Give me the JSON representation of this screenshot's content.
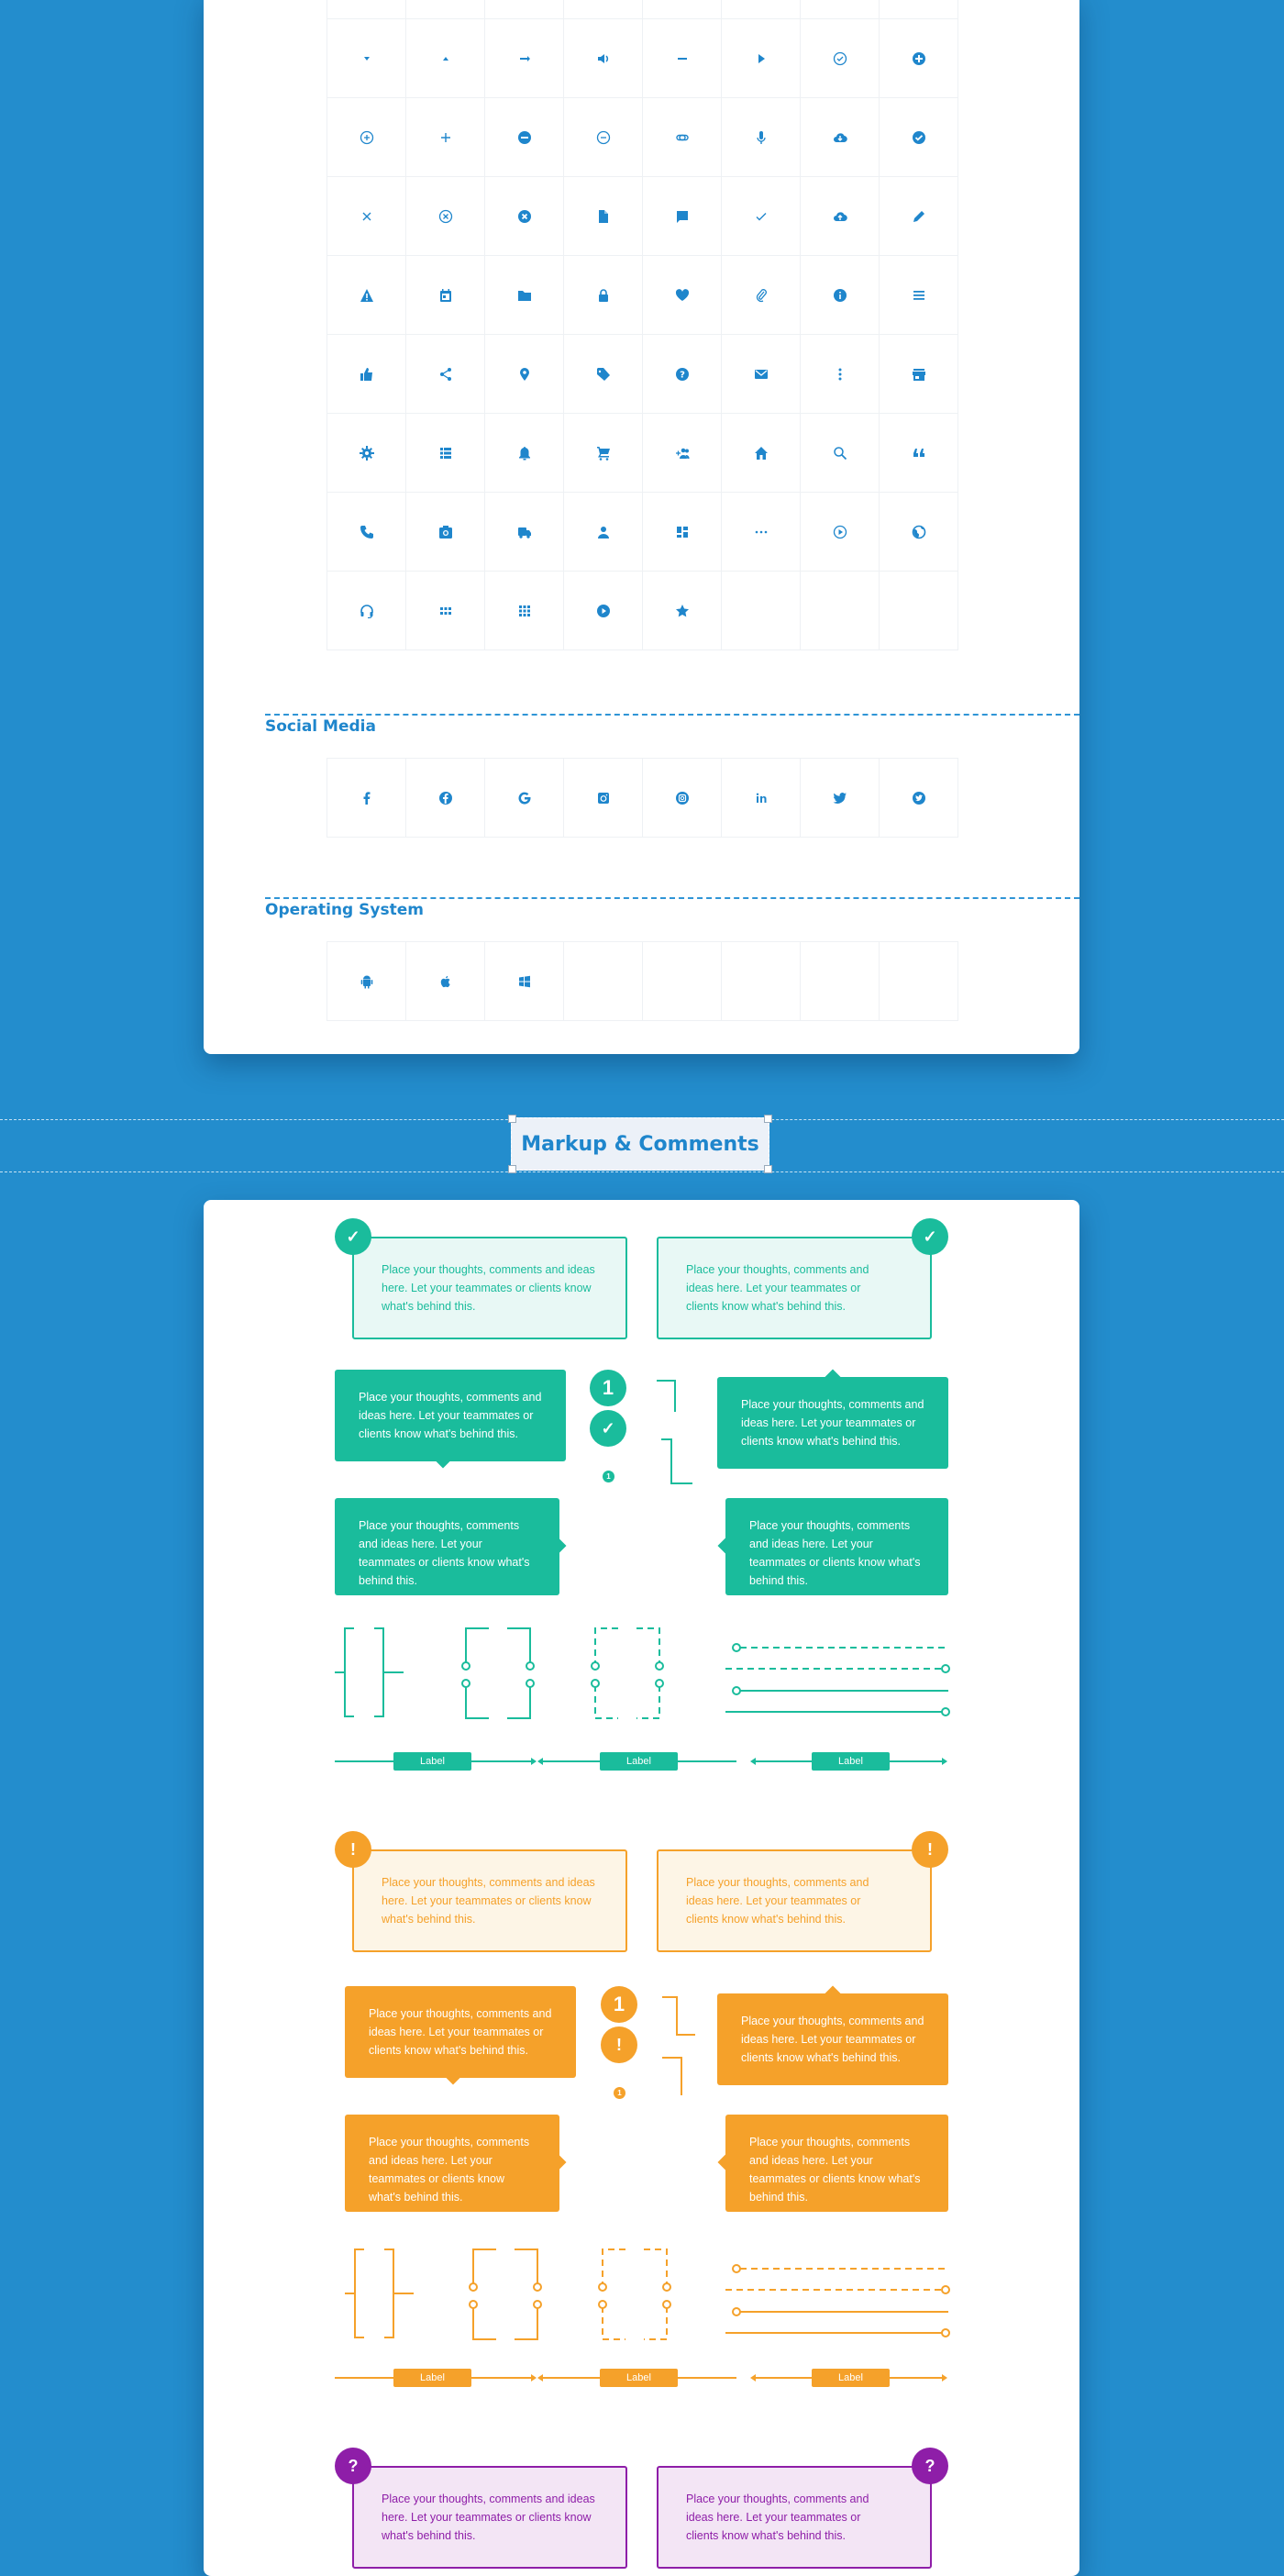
{
  "colors": {
    "background": "#238dcd",
    "icon": "#1f86cc",
    "green": "#1abc9c",
    "green_light": "#e8f8f5",
    "orange": "#f5a12a",
    "orange_light": "#fdf5e6",
    "purple": "#8e1ea8",
    "purple_light": "#f3e5f5"
  },
  "icon_grid": {
    "rows": [
      [
        "caret-down",
        "caret-up",
        "arrow-right",
        "volume",
        "minus",
        "play-triangle",
        "check-circle-outline",
        "plus-circle-filled"
      ],
      [
        "plus-circle-outline",
        "plus",
        "minus-circle-filled",
        "minus-circle-outline",
        "link",
        "microphone",
        "cloud-download",
        "check-circle-filled"
      ],
      [
        "close",
        "close-circle-outline",
        "close-circle-filled",
        "file",
        "comment",
        "check",
        "cloud-upload",
        "pencil"
      ],
      [
        "warning",
        "calendar",
        "folder",
        "lock",
        "heart",
        "paperclip",
        "info",
        "menu"
      ],
      [
        "thumbs-up",
        "share",
        "map-pin",
        "tag",
        "help",
        "mail",
        "more-vertical",
        "store"
      ],
      [
        "settings",
        "list",
        "bell",
        "cart",
        "add-group",
        "home",
        "search",
        "quote"
      ],
      [
        "phone",
        "camera",
        "truck",
        "user",
        "dashboard",
        "more-horizontal",
        "play-circle-outline",
        "globe"
      ],
      [
        "headset",
        "apps-small",
        "apps",
        "play-circle-filled",
        "star",
        "",
        "",
        ""
      ]
    ]
  },
  "sections": [
    {
      "title": "Social Media",
      "icons": [
        "facebook",
        "facebook-circle",
        "google",
        "instagram",
        "instagram-circle",
        "linkedin",
        "twitter",
        "twitter-circle"
      ]
    },
    {
      "title": "Operating System",
      "icons": [
        "android",
        "apple",
        "windows",
        "",
        "",
        "",
        "",
        ""
      ]
    }
  ],
  "divider": {
    "title": "Markup & Comments"
  },
  "comment_text_a": "Place your thoughts, comments and ideas here. Let your teammates or clients know what's behind this.",
  "comment_text_b": "Place your thoughts, comments and ideas here. Let your teammates or clients know what's behind this.",
  "markup": {
    "green": {
      "badge": "✓",
      "number": "1",
      "small_number": "1",
      "labels": [
        "Label",
        "Label",
        "Label"
      ]
    },
    "orange": {
      "badge": "!",
      "number": "1",
      "small_number": "1",
      "labels": [
        "Label",
        "Label",
        "Label"
      ]
    },
    "purple": {
      "badge": "?"
    }
  }
}
